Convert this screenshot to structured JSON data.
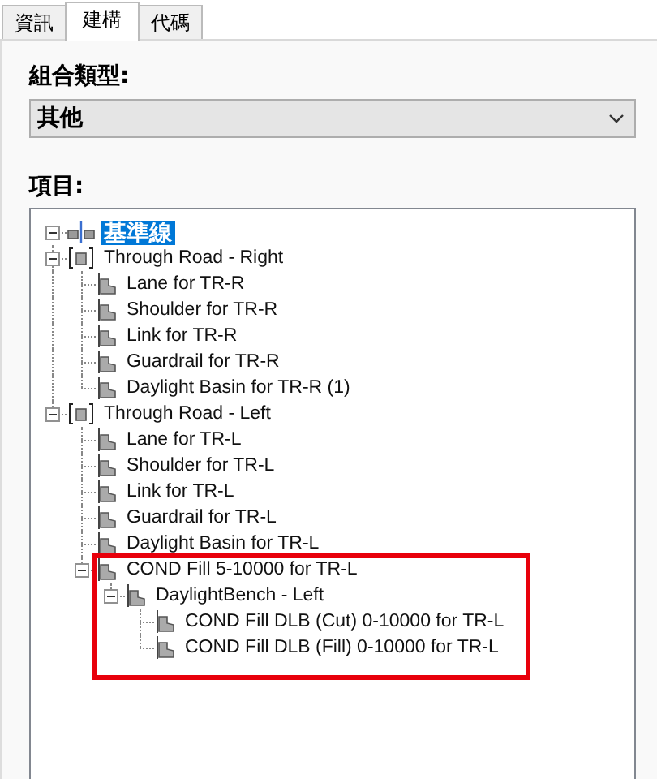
{
  "tabs": [
    {
      "label": "資訊",
      "selected": false
    },
    {
      "label": "建構",
      "selected": true
    },
    {
      "label": "代碼",
      "selected": false
    }
  ],
  "assembly_type": {
    "label": "組合類型:",
    "value": "其他"
  },
  "items": {
    "label": "項目:",
    "tree": {
      "label": "基準線",
      "kind": "baseline",
      "selected": true,
      "expanded": true,
      "children": [
        {
          "label": "Through Road - Right",
          "kind": "region",
          "selected": false,
          "expanded": true,
          "children": [
            {
              "label": "Lane for TR-R",
              "kind": "subassembly",
              "selected": false
            },
            {
              "label": "Shoulder for TR-R",
              "kind": "subassembly",
              "selected": false
            },
            {
              "label": "Link for TR-R",
              "kind": "subassembly",
              "selected": false
            },
            {
              "label": "Guardrail for TR-R",
              "kind": "subassembly",
              "selected": false
            },
            {
              "label": "Daylight Basin for TR-R (1)",
              "kind": "subassembly",
              "selected": false
            }
          ]
        },
        {
          "label": "Through Road - Left",
          "kind": "region",
          "selected": false,
          "expanded": true,
          "children": [
            {
              "label": "Lane for TR-L",
              "kind": "subassembly",
              "selected": false
            },
            {
              "label": "Shoulder for TR-L",
              "kind": "subassembly",
              "selected": false
            },
            {
              "label": "Link for TR-L",
              "kind": "subassembly",
              "selected": false
            },
            {
              "label": "Guardrail for TR-L",
              "kind": "subassembly",
              "selected": false
            },
            {
              "label": "Daylight Basin for TR-L",
              "kind": "subassembly",
              "selected": false
            },
            {
              "label": "COND Fill 5-10000 for TR-L",
              "kind": "subassembly",
              "selected": false,
              "expanded": true,
              "highlighted": true,
              "children": [
                {
                  "label": "DaylightBench - Left",
                  "kind": "subassembly",
                  "selected": false,
                  "expanded": true,
                  "children": [
                    {
                      "label": "COND Fill DLB (Cut) 0-10000 for TR-L",
                      "kind": "subassembly",
                      "selected": false
                    },
                    {
                      "label": "COND Fill DLB (Fill) 0-10000 for TR-L",
                      "kind": "subassembly",
                      "selected": false
                    }
                  ]
                }
              ]
            }
          ]
        }
      ]
    }
  }
}
